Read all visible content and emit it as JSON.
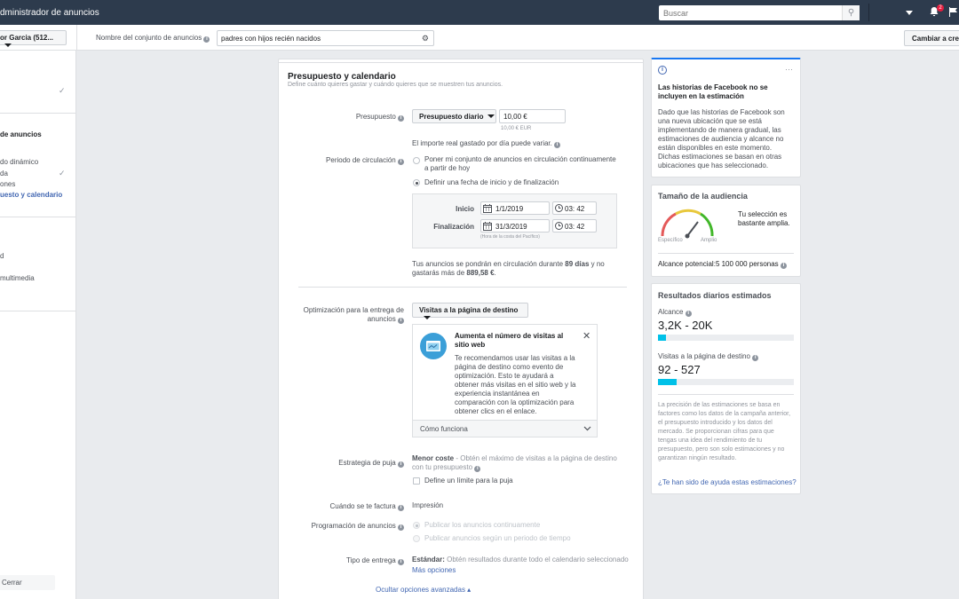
{
  "header": {
    "app_title": "dministrador de anuncios",
    "search_placeholder": "Buscar",
    "notifications_count": "2"
  },
  "subbar": {
    "account": "or Garcia (512...",
    "adset_label": "Nombre del conjunto de anuncios",
    "adset_value": "padres con hijos recién nacidos",
    "switch_button": "Cambiar a crea"
  },
  "leftnav": {
    "section": "de anuncios",
    "items": [
      "do dinámico",
      "da",
      "ones",
      "uesto y calendario",
      "d",
      " multimedia"
    ],
    "close": "Cerrar"
  },
  "budget": {
    "title": "Presupuesto y calendario",
    "subtitle": "Define cuánto quieres gastar y cuándo quieres que se muestren tus anuncios.",
    "budget_label": "Presupuesto",
    "budget_type": "Presupuesto diario",
    "budget_value": "10,00 €",
    "budget_hint": "10,00 € EUR",
    "daily_note": "El importe real gastado por día puede variar.",
    "schedule_label": "Periodo de circulación",
    "option_continuous": "Poner mi conjunto de anuncios en circulación continuamente a partir de hoy",
    "option_dates": "Definir una fecha de inicio y de finalización",
    "start_label": "Inicio",
    "start_date": "1/1/2019",
    "start_time": "03: 42",
    "end_label": "Finalización",
    "end_date": "31/3/2019",
    "end_time": "03: 42",
    "timezone": "(Hora de la costa del Pacífico)",
    "summary_a": "Tus anuncios se pondrán en circulación durante ",
    "summary_days": "89 días",
    "summary_b": " y no gastarás más de ",
    "summary_amount": "889,58 €",
    "summary_c": "."
  },
  "optimization": {
    "label": "Optimización para la entrega de anuncios",
    "value": "Visitas a la página de destino",
    "tip_title": "Aumenta el número de visitas al sitio web",
    "tip_body": "Te recomendamos usar las visitas a la página de destino como evento de optimización. Esto te ayudará a obtener más visitas en el sitio web y la experiencia instantánea en comparación con la optimización para obtener clics en el enlace.",
    "tip_footer": "Cómo funciona"
  },
  "bidding": {
    "label": "Estrategia de puja",
    "strategy_name": "Menor coste",
    "strategy_desc": " - Obtén el máximo de visitas a la página de destino con tu presupuesto",
    "cap_label": "Define un límite para la puja",
    "billing_label": "Cuándo se te factura",
    "billing_value": "Impresión",
    "schedule_label": "Programación de anuncios",
    "schedule_opt1": "Publicar los anuncios continuamente",
    "schedule_opt2": "Publicar anuncios según un periodo de tiempo",
    "delivery_label": "Tipo de entrega",
    "delivery_name": "Estándar:",
    "delivery_desc": " Obtén resultados durante todo el calendario seleccionado",
    "more_options": "Más opciones",
    "hide_advanced": "Ocultar opciones avanzadas"
  },
  "stories_card": {
    "title": "Las historias de Facebook no se incluyen en la estimación",
    "body": "Dado que las historias de Facebook son una nueva ubicación que se está implementando de manera gradual, las estimaciones de audiencia y alcance no están disponibles en este momento. Dichas estimaciones se basan en otras ubicaciones que has seleccionado."
  },
  "audience": {
    "title": "Tamaño de la audiencia",
    "verdict": "Tu selección es bastante amplia.",
    "specific": "Específico",
    "broad": "Amplio",
    "reach_label": "Alcance potencial:",
    "reach_value": "5 100 000 personas"
  },
  "results": {
    "title": "Resultados diarios estimados",
    "reach_label": "Alcance",
    "reach_value": "3,2K - 20K",
    "reach_fill": 0.06,
    "visits_label": "Visitas a la página de destino",
    "visits_value": "92 - 527",
    "visits_fill": 0.14,
    "note": "La precisión de las estimaciones se basa en factores como los datos de la campaña anterior, el presupuesto introducido y los datos del mercado. Se proporcionan cifras para que tengas una idea del rendimiento de tu presupuesto, pero son solo estimaciones y no garantizan ningún resultado.",
    "feedback": "¿Te han sido de ayuda estas estimaciones?"
  },
  "colors": {
    "topbar": "#2d3b4d",
    "link": "#4267b2",
    "bar": "#00c1e8",
    "accent_border": "#1877f2"
  }
}
